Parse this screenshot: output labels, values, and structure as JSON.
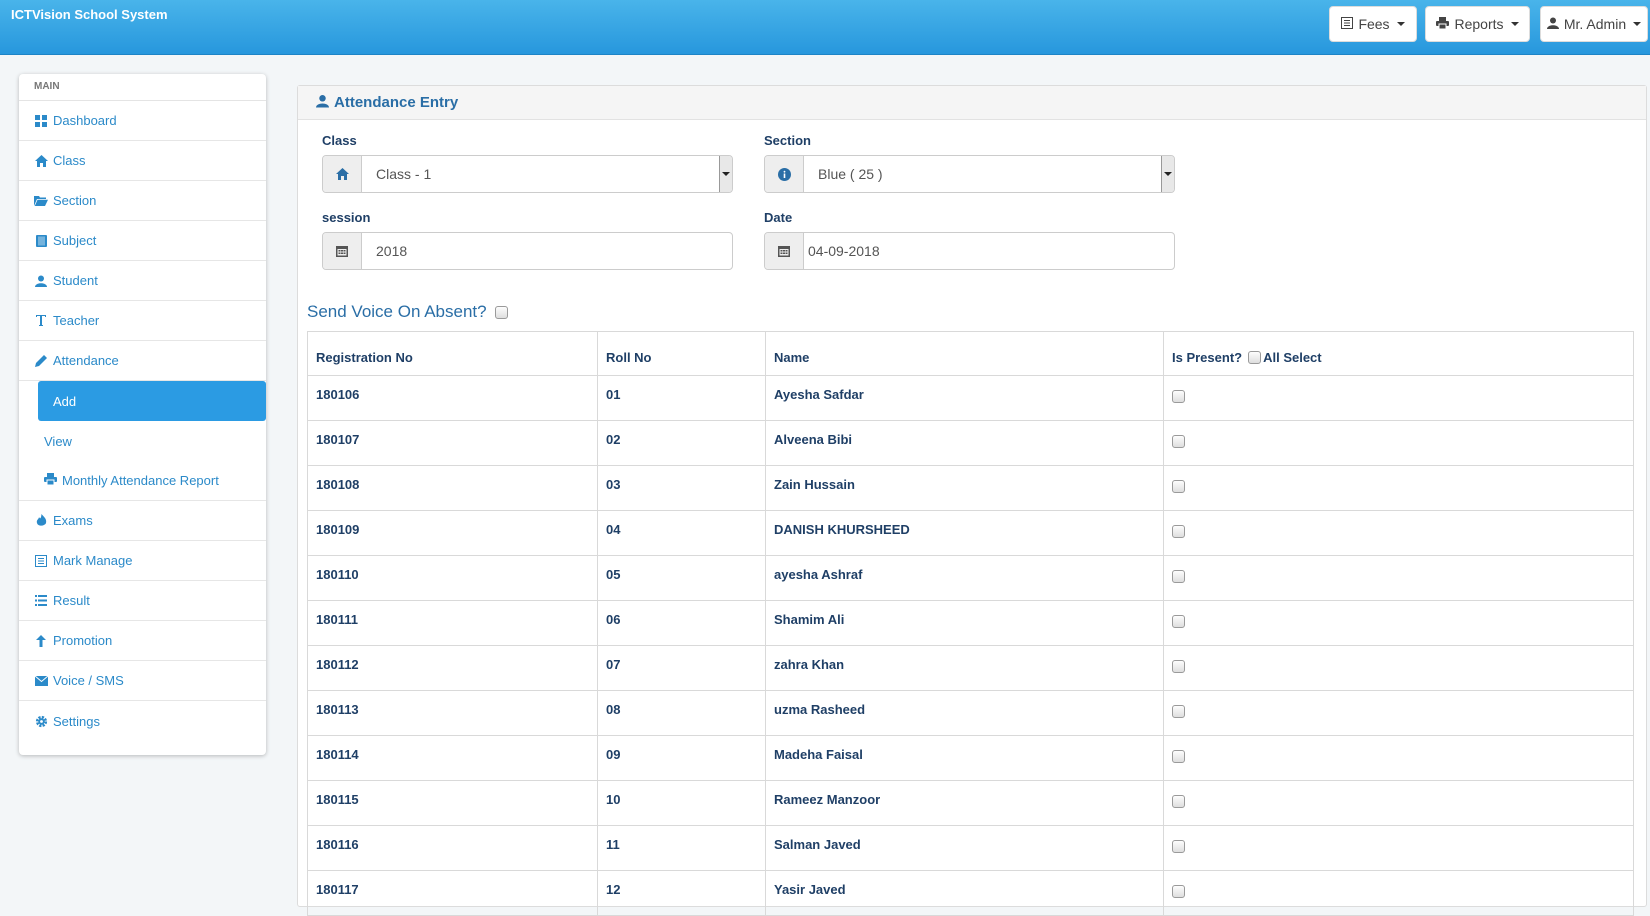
{
  "app": {
    "title": "ICTVision School System"
  },
  "topnav": {
    "fees": "Fees",
    "reports": "Reports",
    "user": "Mr. Admin"
  },
  "sidebar": {
    "header": "MAIN",
    "items": [
      {
        "label": "Dashboard",
        "icon": "dashboard-icon"
      },
      {
        "label": "Class",
        "icon": "home-icon"
      },
      {
        "label": "Section",
        "icon": "folder-open-icon"
      },
      {
        "label": "Subject",
        "icon": "book-icon"
      },
      {
        "label": "Student",
        "icon": "user-icon"
      },
      {
        "label": "Teacher",
        "icon": "text-cursor-icon"
      },
      {
        "label": "Attendance",
        "icon": "pencil-icon"
      }
    ],
    "attendance_sub": {
      "add": "Add",
      "view": "View",
      "monthly": "Monthly Attendance Report"
    },
    "items_after": [
      {
        "label": "Exams",
        "icon": "fire-icon"
      },
      {
        "label": "Mark Manage",
        "icon": "list-alt-icon"
      },
      {
        "label": "Result",
        "icon": "list-icon"
      },
      {
        "label": "Promotion",
        "icon": "arrow-up-icon"
      },
      {
        "label": "Voice / SMS",
        "icon": "envelope-icon"
      },
      {
        "label": "Settings",
        "icon": "gear-icon"
      }
    ]
  },
  "panel": {
    "title": "Attendance Entry"
  },
  "form": {
    "class_label": "Class",
    "class_value": "Class - 1",
    "section_label": "Section",
    "section_value": "Blue ( 25 )",
    "session_label": "session",
    "session_value": "2018",
    "date_label": "Date",
    "date_value": "04-09-2018"
  },
  "voice_label": "Send Voice On Absent?",
  "table": {
    "headers": {
      "reg": "Registration No",
      "roll": "Roll No",
      "name": "Name",
      "present": "Is Present?",
      "all_select": "All Select"
    },
    "rows": [
      {
        "reg": "180106",
        "roll": "01",
        "name": "Ayesha Safdar"
      },
      {
        "reg": "180107",
        "roll": "02",
        "name": "Alveena Bibi"
      },
      {
        "reg": "180108",
        "roll": "03",
        "name": "Zain Hussain"
      },
      {
        "reg": "180109",
        "roll": "04",
        "name": "DANISH KHURSHEED"
      },
      {
        "reg": "180110",
        "roll": "05",
        "name": "ayesha Ashraf"
      },
      {
        "reg": "180111",
        "roll": "06",
        "name": "Shamim Ali"
      },
      {
        "reg": "180112",
        "roll": "07",
        "name": "zahra Khan"
      },
      {
        "reg": "180113",
        "roll": "08",
        "name": "uzma Rasheed"
      },
      {
        "reg": "180114",
        "roll": "09",
        "name": "Madeha Faisal"
      },
      {
        "reg": "180115",
        "roll": "10",
        "name": "Rameez Manzoor"
      },
      {
        "reg": "180116",
        "roll": "11",
        "name": "Salman Javed"
      },
      {
        "reg": "180117",
        "roll": "12",
        "name": "Yasir Javed"
      }
    ]
  }
}
